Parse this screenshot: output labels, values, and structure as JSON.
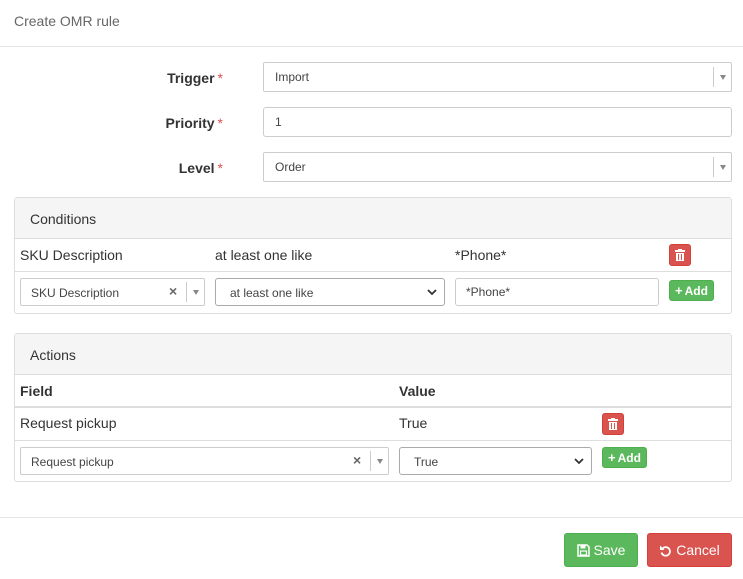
{
  "modal": {
    "title": "Create OMR rule"
  },
  "form": {
    "trigger": {
      "label": "Trigger",
      "required_mark": "*",
      "value": "Import"
    },
    "priority": {
      "label": "Priority",
      "required_mark": "*",
      "value": "1"
    },
    "level": {
      "label": "Level",
      "required_mark": "*",
      "value": "Order"
    }
  },
  "conditions": {
    "title": "Conditions",
    "rows": [
      {
        "field": "SKU Description",
        "operator": "at least one like",
        "value": "*Phone*"
      }
    ],
    "new_row": {
      "field": "SKU Description",
      "clear_glyph": "×",
      "operator": "at least one like",
      "value": "*Phone*",
      "add_label": "Add"
    }
  },
  "actions": {
    "title": "Actions",
    "columns": {
      "field": "Field",
      "value": "Value"
    },
    "rows": [
      {
        "field": "Request pickup",
        "value": "True"
      }
    ],
    "new_row": {
      "field": "Request pickup",
      "clear_glyph": "×",
      "value": "True",
      "add_label": "Add"
    }
  },
  "footer": {
    "save_label": "Save",
    "cancel_label": "Cancel"
  },
  "colors": {
    "success": "#5cb85c",
    "danger": "#d9534f",
    "border": "#dddddd",
    "panel_heading": "#f5f5f5"
  },
  "icons": {
    "delete": "trash-icon",
    "add": "plus-icon",
    "save": "floppy-disk-icon",
    "cancel": "undo-icon",
    "dropdown": "caret-down-icon"
  }
}
